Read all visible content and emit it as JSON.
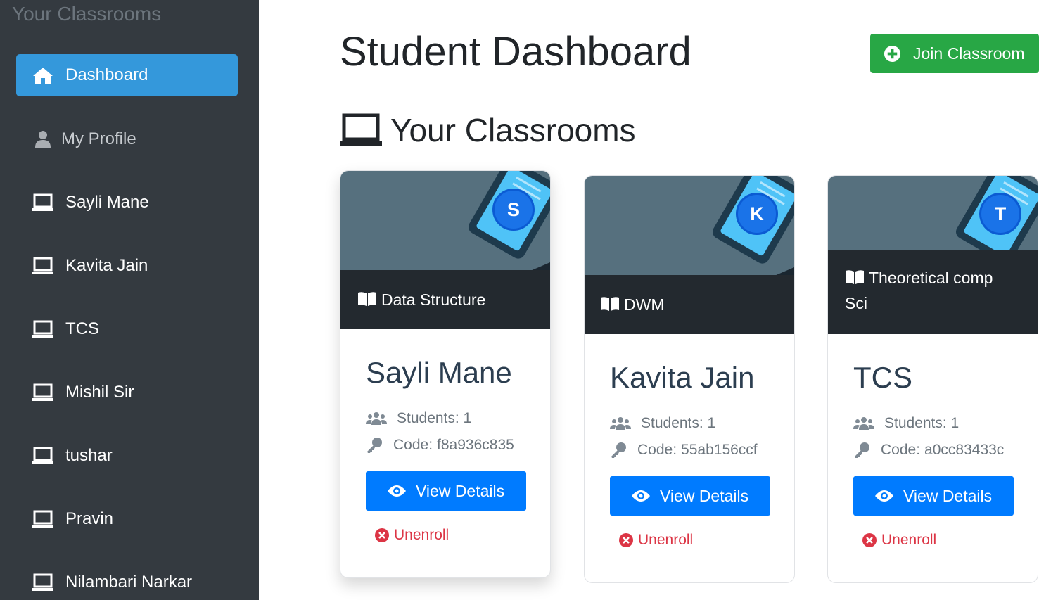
{
  "sidebar": {
    "title": "Your Classrooms",
    "items": [
      {
        "label": "Dashboard",
        "icon": "home-icon"
      },
      {
        "label": "My Profile",
        "icon": "user-icon"
      },
      {
        "label": "Sayli Mane",
        "icon": "laptop-icon"
      },
      {
        "label": "Kavita Jain",
        "icon": "laptop-icon"
      },
      {
        "label": "TCS",
        "icon": "laptop-icon"
      },
      {
        "label": "Mishil Sir",
        "icon": "laptop-icon"
      },
      {
        "label": "tushar",
        "icon": "laptop-icon"
      },
      {
        "label": "Pravin",
        "icon": "laptop-icon"
      },
      {
        "label": "Nilambari Narkar",
        "icon": "laptop-icon"
      }
    ]
  },
  "header": {
    "title": "Student Dashboard",
    "join_label": "Join Classroom"
  },
  "section": {
    "heading": "Your Classrooms"
  },
  "cards": [
    {
      "initial": "S",
      "subject_line1": "Data Structure",
      "subject_line2": "",
      "teacher": "Sayli Mane",
      "students": "Students: 1",
      "code_label": "Code:",
      "code": "f8a936c835",
      "view_label": "View Details",
      "unenroll_label": "Unenroll"
    },
    {
      "initial": "K",
      "subject_line1": "DWM",
      "subject_line2": "",
      "teacher": "Kavita Jain",
      "students": "Students: 1",
      "code_label": "Code:",
      "code": "55ab156ccf",
      "view_label": "View Details",
      "unenroll_label": "Unenroll"
    },
    {
      "initial": "T",
      "subject_line1": "Theoretical comp",
      "subject_line2": "Sci",
      "teacher": "TCS",
      "students": "Students: 1",
      "code_label": "Code:",
      "code": "a0cc83433c",
      "view_label": "View Details",
      "unenroll_label": "Unenroll"
    }
  ],
  "colors": {
    "sidebar_bg": "#343a40",
    "active_item": "#3498db",
    "join_button": "#28a745",
    "view_button": "#007bff",
    "unenroll": "#dc3545",
    "avatar": "#1a73e8"
  }
}
